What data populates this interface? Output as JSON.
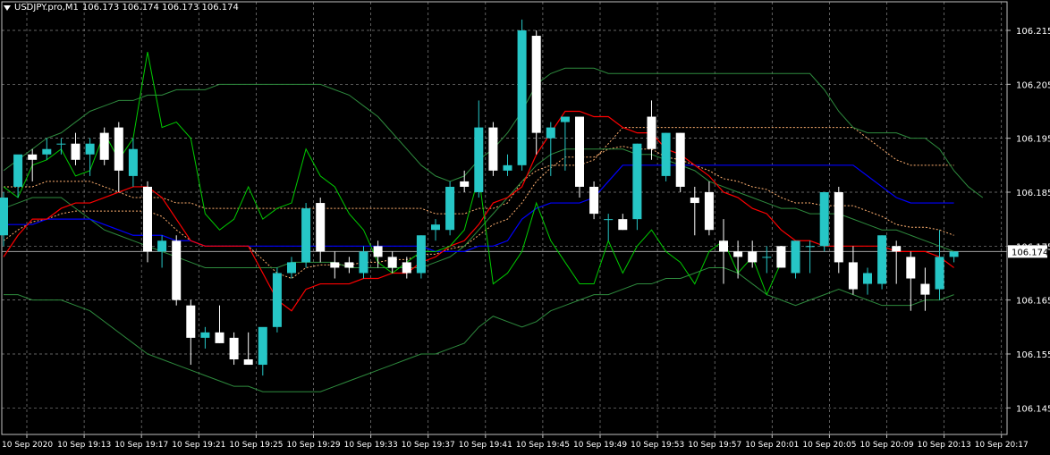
{
  "header": {
    "symbol": "USDJPY.pro,M1",
    "quotes": "106.173 106.174 106.173 106.174"
  },
  "colors": {
    "background": "#000000",
    "grid": "#c0c0c0",
    "text": "#ffffff",
    "bull_candle": "#26c6c6",
    "bear_candle": "#ffffff",
    "bollinger": "#2e8b3e",
    "tenkan": "#ff0000",
    "kijun": "#0000ff",
    "chikou": "#00cc00",
    "cloud": "#ffb070",
    "price_line": "#a0a0a0"
  },
  "chart_data": {
    "type": "candlestick",
    "ylim": [
      106.141,
      106.219
    ],
    "y_ticks": [
      106.215,
      106.205,
      106.195,
      106.185,
      106.175,
      106.165,
      106.155,
      106.145
    ],
    "y_tick_labels": [
      "106.215",
      "106.205",
      "106.195",
      "106.185",
      "106.175",
      "106.165",
      "106.155",
      "106.145"
    ],
    "x_labels": [
      "10 Sep 2020",
      "10 Sep 19:13",
      "10 Sep 19:17",
      "10 Sep 19:21",
      "10 Sep 19:25",
      "10 Sep 19:29",
      "10 Sep 19:33",
      "10 Sep 19:37",
      "10 Sep 19:41",
      "10 Sep 19:45",
      "10 Sep 19:49",
      "10 Sep 19:53",
      "10 Sep 19:57",
      "10 Sep 20:01",
      "10 Sep 20:05",
      "10 Sep 20:09",
      "10 Sep 20:13",
      "10 Sep 20:17"
    ],
    "current_price": 106.174,
    "current_price_label": "106.174",
    "candles": [
      {
        "o": 106.177,
        "h": 106.185,
        "l": 106.175,
        "c": 106.184
      },
      {
        "o": 106.186,
        "h": 106.191,
        "l": 106.184,
        "c": 106.192
      },
      {
        "o": 106.192,
        "h": 106.193,
        "l": 106.187,
        "c": 106.191
      },
      {
        "o": 106.192,
        "h": 106.195,
        "l": 106.191,
        "c": 106.193
      },
      {
        "o": 106.194,
        "h": 106.195,
        "l": 106.192,
        "c": 106.194
      },
      {
        "o": 106.194,
        "h": 106.196,
        "l": 106.19,
        "c": 106.191
      },
      {
        "o": 106.192,
        "h": 106.195,
        "l": 106.188,
        "c": 106.194
      },
      {
        "o": 106.196,
        "h": 106.197,
        "l": 106.19,
        "c": 106.191
      },
      {
        "o": 106.197,
        "h": 106.198,
        "l": 106.185,
        "c": 106.189
      },
      {
        "o": 106.188,
        "h": 106.195,
        "l": 106.186,
        "c": 106.193
      },
      {
        "o": 106.186,
        "h": 106.187,
        "l": 106.172,
        "c": 106.174
      },
      {
        "o": 106.174,
        "h": 106.177,
        "l": 106.171,
        "c": 106.176
      },
      {
        "o": 106.176,
        "h": 106.177,
        "l": 106.164,
        "c": 106.165
      },
      {
        "o": 106.164,
        "h": 106.165,
        "l": 106.153,
        "c": 106.158
      },
      {
        "o": 106.158,
        "h": 106.16,
        "l": 106.156,
        "c": 106.159
      },
      {
        "o": 106.159,
        "h": 106.164,
        "l": 106.157,
        "c": 106.157
      },
      {
        "o": 106.158,
        "h": 106.159,
        "l": 106.153,
        "c": 106.154
      },
      {
        "o": 106.154,
        "h": 106.159,
        "l": 106.153,
        "c": 106.153
      },
      {
        "o": 106.153,
        "h": 106.159,
        "l": 106.151,
        "c": 106.16
      },
      {
        "o": 106.16,
        "h": 106.171,
        "l": 106.159,
        "c": 106.17
      },
      {
        "o": 106.17,
        "h": 106.173,
        "l": 106.169,
        "c": 106.172
      },
      {
        "o": 106.172,
        "h": 106.183,
        "l": 106.171,
        "c": 106.182
      },
      {
        "o": 106.183,
        "h": 106.184,
        "l": 106.172,
        "c": 106.174
      },
      {
        "o": 106.172,
        "h": 106.174,
        "l": 106.169,
        "c": 106.171
      },
      {
        "o": 106.172,
        "h": 106.173,
        "l": 106.17,
        "c": 106.171
      },
      {
        "o": 106.17,
        "h": 106.175,
        "l": 106.169,
        "c": 106.174
      },
      {
        "o": 106.175,
        "h": 106.176,
        "l": 106.171,
        "c": 106.173
      },
      {
        "o": 106.173,
        "h": 106.174,
        "l": 106.17,
        "c": 106.171
      },
      {
        "o": 106.172,
        "h": 106.173,
        "l": 106.169,
        "c": 106.17
      },
      {
        "o": 106.17,
        "h": 106.177,
        "l": 106.169,
        "c": 106.177
      },
      {
        "o": 106.178,
        "h": 106.18,
        "l": 106.176,
        "c": 106.179
      },
      {
        "o": 106.178,
        "h": 106.187,
        "l": 106.177,
        "c": 106.186
      },
      {
        "o": 106.187,
        "h": 106.189,
        "l": 106.185,
        "c": 106.186
      },
      {
        "o": 106.185,
        "h": 106.202,
        "l": 106.184,
        "c": 106.197
      },
      {
        "o": 106.197,
        "h": 106.198,
        "l": 106.188,
        "c": 106.189
      },
      {
        "o": 106.189,
        "h": 106.192,
        "l": 106.188,
        "c": 106.19
      },
      {
        "o": 106.19,
        "h": 106.217,
        "l": 106.189,
        "c": 106.215
      },
      {
        "o": 106.214,
        "h": 106.215,
        "l": 106.192,
        "c": 106.196
      },
      {
        "o": 106.195,
        "h": 106.198,
        "l": 106.188,
        "c": 106.197
      },
      {
        "o": 106.198,
        "h": 106.199,
        "l": 106.189,
        "c": 106.199
      },
      {
        "o": 106.199,
        "h": 106.199,
        "l": 106.184,
        "c": 106.186
      },
      {
        "o": 106.186,
        "h": 106.187,
        "l": 106.18,
        "c": 106.181
      },
      {
        "o": 106.18,
        "h": 106.181,
        "l": 106.176,
        "c": 106.18
      },
      {
        "o": 106.18,
        "h": 106.181,
        "l": 106.178,
        "c": 106.178
      },
      {
        "o": 106.18,
        "h": 106.194,
        "l": 106.178,
        "c": 106.194
      },
      {
        "o": 106.199,
        "h": 106.202,
        "l": 106.191,
        "c": 106.193
      },
      {
        "o": 106.188,
        "h": 106.196,
        "l": 106.187,
        "c": 106.196
      },
      {
        "o": 106.196,
        "h": 106.196,
        "l": 106.185,
        "c": 106.186
      },
      {
        "o": 106.184,
        "h": 106.186,
        "l": 106.177,
        "c": 106.183
      },
      {
        "o": 106.185,
        "h": 106.187,
        "l": 106.177,
        "c": 106.178
      },
      {
        "o": 106.176,
        "h": 106.18,
        "l": 106.168,
        "c": 106.174
      },
      {
        "o": 106.174,
        "h": 106.176,
        "l": 106.169,
        "c": 106.173
      },
      {
        "o": 106.174,
        "h": 106.176,
        "l": 106.171,
        "c": 106.172
      },
      {
        "o": 106.173,
        "h": 106.175,
        "l": 106.17,
        "c": 106.173
      },
      {
        "o": 106.175,
        "h": 106.175,
        "l": 106.171,
        "c": 106.171
      },
      {
        "o": 106.17,
        "h": 106.176,
        "l": 106.169,
        "c": 106.176
      },
      {
        "o": 106.175,
        "h": 106.176,
        "l": 106.17,
        "c": 106.175
      },
      {
        "o": 106.175,
        "h": 106.185,
        "l": 106.174,
        "c": 106.185
      },
      {
        "o": 106.185,
        "h": 106.186,
        "l": 106.17,
        "c": 106.172
      },
      {
        "o": 106.172,
        "h": 106.175,
        "l": 106.166,
        "c": 106.167
      },
      {
        "o": 106.168,
        "h": 106.171,
        "l": 106.166,
        "c": 106.17
      },
      {
        "o": 106.168,
        "h": 106.177,
        "l": 106.167,
        "c": 106.177
      },
      {
        "o": 106.175,
        "h": 106.176,
        "l": 106.168,
        "c": 106.174
      },
      {
        "o": 106.173,
        "h": 106.174,
        "l": 106.163,
        "c": 106.169
      },
      {
        "o": 106.168,
        "h": 106.171,
        "l": 106.163,
        "c": 106.166
      },
      {
        "o": 106.167,
        "h": 106.178,
        "l": 106.165,
        "c": 106.173
      },
      {
        "o": 106.173,
        "h": 106.174,
        "l": 106.172,
        "c": 106.174
      }
    ],
    "bollinger_upper": [
      106.189,
      106.191,
      106.193,
      106.195,
      106.196,
      106.198,
      106.2,
      106.201,
      106.202,
      106.202,
      106.203,
      106.203,
      106.204,
      106.204,
      106.204,
      106.205,
      106.205,
      106.205,
      106.205,
      106.205,
      106.205,
      106.205,
      106.205,
      106.204,
      106.203,
      106.201,
      106.199,
      106.196,
      106.193,
      106.19,
      106.188,
      106.187,
      106.188,
      106.191,
      106.193,
      106.196,
      106.2,
      106.205,
      106.207,
      106.208,
      106.208,
      106.208,
      106.207,
      106.207,
      106.207,
      106.207,
      106.207,
      106.207,
      106.207,
      106.207,
      106.207,
      106.207,
      106.207,
      106.207,
      106.207,
      106.207,
      106.207,
      106.204,
      106.2,
      106.197,
      106.196,
      106.196,
      106.196,
      106.195,
      106.195,
      106.193,
      106.189,
      106.186,
      106.184
    ],
    "bollinger_middle": [
      106.182,
      106.183,
      106.184,
      106.184,
      106.184,
      106.182,
      106.18,
      106.178,
      106.177,
      106.176,
      106.175,
      106.174,
      106.173,
      106.172,
      106.171,
      106.171,
      106.171,
      106.171,
      106.171,
      106.171,
      106.172,
      106.172,
      106.172,
      106.172,
      106.171,
      106.171,
      106.171,
      106.171,
      106.171,
      106.171,
      106.172,
      106.173,
      106.175,
      106.178,
      106.181,
      106.184,
      106.187,
      106.19,
      106.192,
      106.193,
      106.193,
      106.193,
      106.193,
      106.193,
      106.192,
      106.192,
      106.191,
      106.19,
      106.189,
      106.187,
      106.186,
      106.185,
      106.184,
      106.183,
      106.182,
      106.182,
      106.181,
      106.181,
      106.181,
      106.18,
      106.179,
      106.178,
      106.178,
      106.177,
      106.176,
      106.175,
      106.174
    ],
    "bollinger_lower": [
      106.166,
      106.166,
      106.165,
      106.165,
      106.165,
      106.164,
      106.163,
      106.161,
      106.159,
      106.157,
      106.155,
      106.154,
      106.153,
      106.152,
      106.151,
      106.15,
      106.149,
      106.149,
      106.148,
      106.148,
      106.148,
      106.148,
      106.148,
      106.149,
      106.15,
      106.151,
      106.152,
      106.153,
      106.154,
      106.155,
      106.155,
      106.156,
      106.157,
      106.16,
      106.162,
      106.161,
      106.16,
      106.161,
      106.163,
      106.164,
      106.165,
      106.166,
      106.166,
      106.167,
      106.168,
      106.168,
      106.169,
      106.169,
      106.17,
      106.171,
      106.171,
      106.17,
      106.168,
      106.166,
      106.165,
      106.164,
      106.165,
      106.166,
      106.167,
      106.166,
      106.165,
      106.164,
      106.164,
      106.164,
      106.165,
      106.165,
      106.166
    ],
    "tenkan": [
      106.173,
      106.177,
      106.18,
      106.18,
      106.182,
      106.183,
      106.183,
      106.184,
      106.185,
      106.186,
      106.186,
      106.184,
      106.18,
      106.176,
      106.175,
      106.175,
      106.175,
      106.175,
      106.17,
      106.165,
      106.163,
      106.167,
      106.168,
      106.168,
      106.168,
      106.169,
      106.169,
      106.17,
      106.17,
      106.172,
      106.173,
      106.175,
      106.176,
      106.179,
      106.183,
      106.184,
      106.186,
      106.192,
      106.196,
      106.2,
      106.2,
      106.199,
      106.199,
      106.197,
      106.196,
      106.196,
      106.193,
      106.192,
      106.19,
      106.188,
      106.185,
      106.184,
      106.182,
      106.181,
      106.178,
      106.176,
      106.176,
      106.175,
      106.175,
      106.175,
      106.175,
      106.175,
      106.174,
      106.174,
      106.174,
      106.173,
      106.171
    ],
    "kijun": [
      106.179,
      106.179,
      106.179,
      106.18,
      106.18,
      106.18,
      106.18,
      106.179,
      106.178,
      106.177,
      106.177,
      106.177,
      106.176,
      106.176,
      106.175,
      106.175,
      106.175,
      106.175,
      106.175,
      106.175,
      106.175,
      106.175,
      106.175,
      106.175,
      106.175,
      106.175,
      106.175,
      106.175,
      106.175,
      106.175,
      106.174,
      106.174,
      106.174,
      106.175,
      106.175,
      106.176,
      106.18,
      106.182,
      106.183,
      106.183,
      106.183,
      106.184,
      106.187,
      106.19,
      106.19,
      106.19,
      106.19,
      106.19,
      106.19,
      106.19,
      106.19,
      106.19,
      106.19,
      106.19,
      106.19,
      106.19,
      106.19,
      106.19,
      106.19,
      106.19,
      106.188,
      106.186,
      106.184,
      106.183,
      106.183,
      106.183,
      106.183
    ],
    "chikou": [
      106.186,
      106.184,
      106.19,
      106.191,
      106.193,
      106.188,
      106.189,
      106.196,
      106.191,
      106.195,
      106.211,
      106.197,
      106.198,
      106.195,
      106.181,
      106.178,
      106.18,
      106.186,
      106.18,
      106.182,
      106.183,
      106.193,
      106.188,
      106.186,
      106.181,
      106.178,
      106.172,
      106.17,
      106.172,
      106.174,
      106.174,
      106.175,
      106.178,
      106.188,
      106.168,
      106.17,
      106.174,
      106.183,
      106.176,
      106.172,
      106.168,
      106.168,
      106.176,
      106.17,
      106.175,
      106.178,
      106.174,
      106.172,
      106.168,
      106.174,
      106.176,
      106.17,
      106.173,
      106.166,
      106.172
    ]
  }
}
